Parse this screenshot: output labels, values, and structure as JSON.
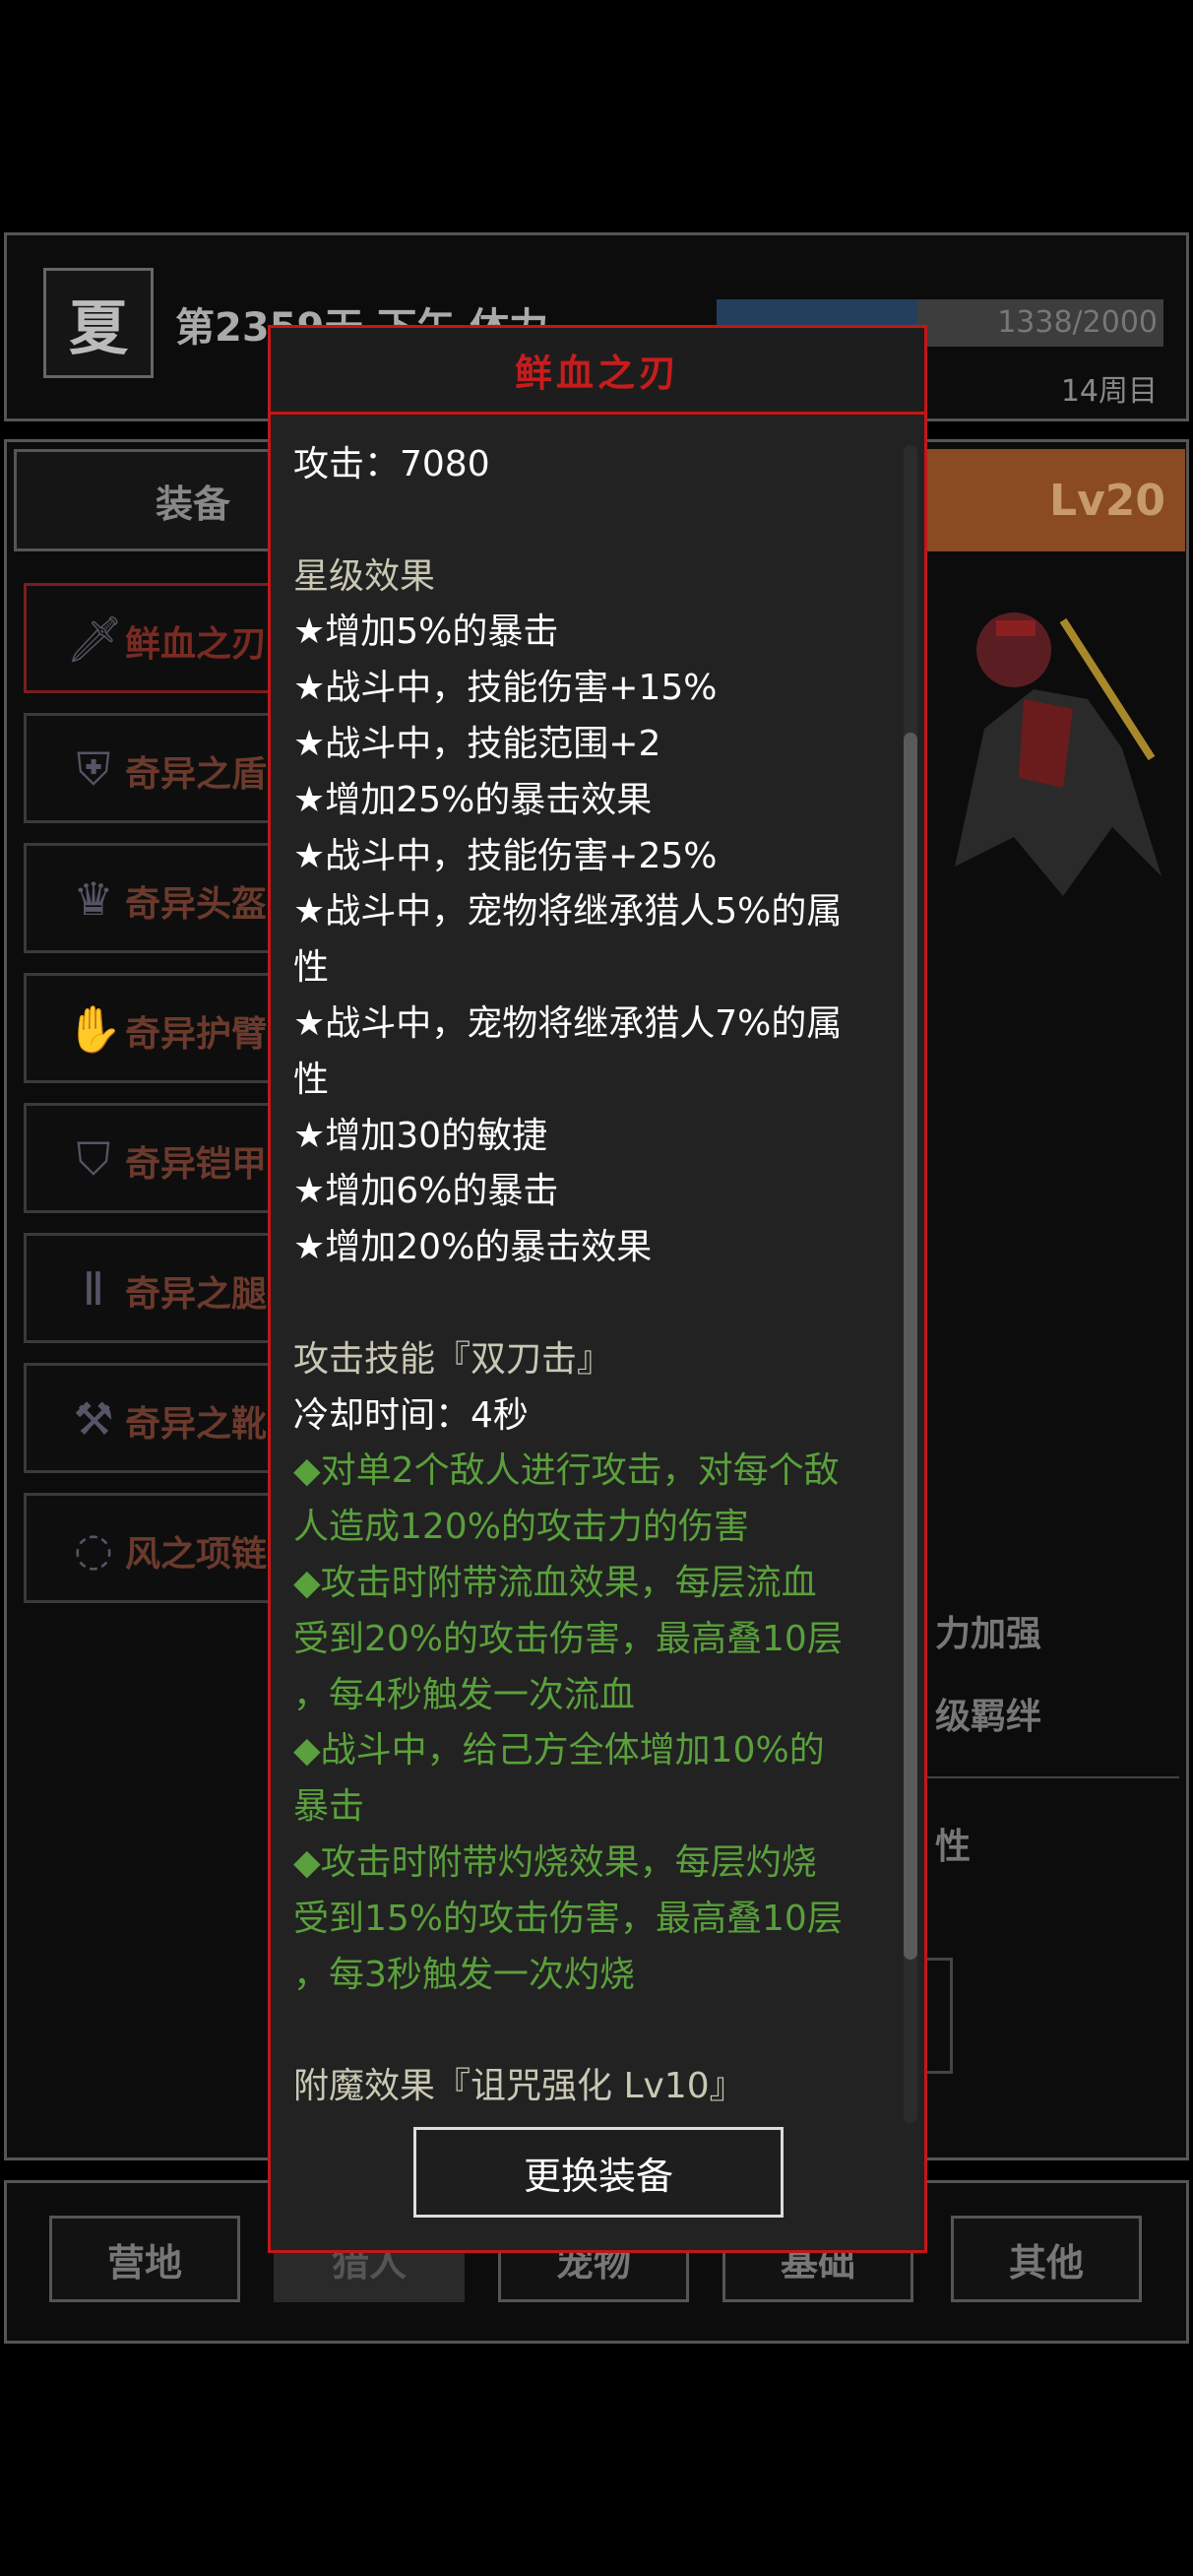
{
  "topbar": {
    "season": "夏",
    "day_text": "第2359天 下午 体力",
    "xp_text": "1338/2000",
    "xp_fraction": 0.45,
    "cycle": "14周目"
  },
  "tabs": {
    "equip_label": "装备",
    "level": "Lv20"
  },
  "slots": [
    {
      "label": "鲜血之刃",
      "icon": "sword-icon",
      "glyph": "🗡"
    },
    {
      "label": "奇异之盾",
      "icon": "shield-icon",
      "glyph": "⛨"
    },
    {
      "label": "奇异头盔",
      "icon": "helmet-icon",
      "glyph": "♛"
    },
    {
      "label": "奇异护臂",
      "icon": "bracer-icon",
      "glyph": "✋"
    },
    {
      "label": "奇异铠甲",
      "icon": "armor-icon",
      "glyph": "⛉"
    },
    {
      "label": "奇异之腿",
      "icon": "leggings-icon",
      "glyph": "Ⅱ"
    },
    {
      "label": "奇异之靴",
      "icon": "boots-icon",
      "glyph": "⚒"
    },
    {
      "label": "风之项链",
      "icon": "necklace-icon",
      "glyph": "◌"
    }
  ],
  "right_texts": [
    "力加强",
    "级羁绊",
    "性"
  ],
  "nav": [
    "营地",
    "猎人",
    "宠物",
    "基础",
    "其他"
  ],
  "popup": {
    "title": "鲜血之刃",
    "attack": "攻击：7080",
    "star_header": "星级效果",
    "star_lines": [
      "★增加5%的暴击",
      "★战斗中，技能伤害+15%",
      "★战斗中，技能范围+2",
      "★增加25%的暴击效果",
      "★战斗中，技能伤害+25%",
      "★战斗中，宠物将继承猎人5%的属",
      "性",
      "★战斗中，宠物将继承猎人7%的属",
      "性",
      "★增加30的敏捷",
      "★增加6%的暴击",
      "★增加20%的暴击效果"
    ],
    "skill_header": "攻击技能『双刀击』",
    "cooldown": "冷却时间：4秒",
    "skill_lines": [
      "◆对单2个敌人进行攻击，对每个敌",
      "人造成120%的攻击力的伤害",
      "◆攻击时附带流血效果，每层流血",
      "受到20%的攻击伤害，最高叠10层",
      "，每4秒触发一次流血",
      "◆战斗中，给己方全体增加10%的",
      "暴击",
      "◆攻击时附带灼烧效果，每层灼烧",
      "受到15%的攻击伤害，最高叠10层",
      "，每3秒触发一次灼烧"
    ],
    "enchant": "附魔效果『诅咒强化 Lv10』",
    "button": "更换装备"
  }
}
